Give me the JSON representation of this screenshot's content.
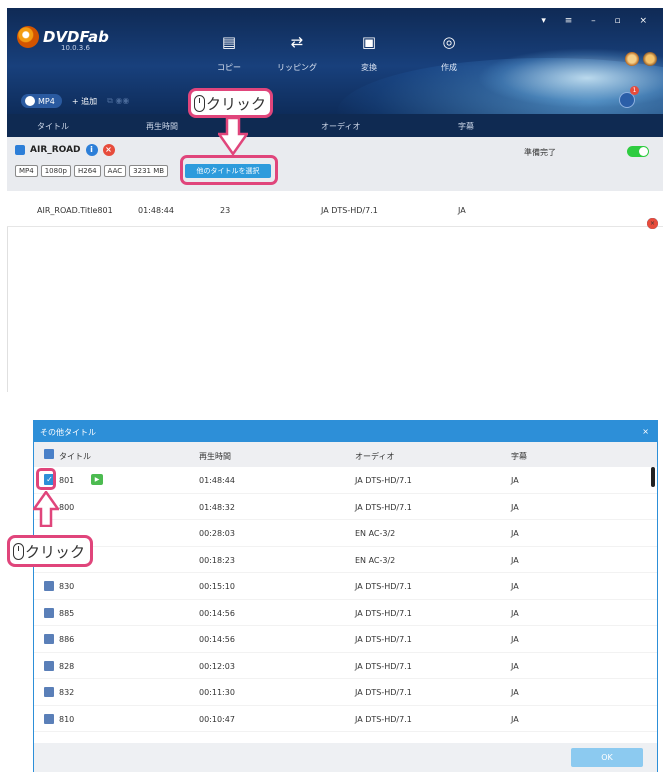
{
  "app": {
    "logo_text": "DVDFab",
    "version": "10.0.3.6",
    "window_controls": "▾ ≡ – ▫ ×",
    "nav": [
      {
        "label": "コピー",
        "icon": "copy-icon"
      },
      {
        "label": "リッピング",
        "icon": "ripper-icon"
      },
      {
        "label": "変換",
        "icon": "converter-icon"
      },
      {
        "label": "作成",
        "icon": "creator-icon"
      }
    ],
    "toolbar": {
      "profile": "MP4",
      "add": "+ 追加",
      "queue_badge": "1"
    },
    "columns": {
      "title": "タイトル",
      "duration": "再生時間",
      "audio": "オーディオ",
      "subtitle": "字幕"
    },
    "source": {
      "name": "AIR_ROAD",
      "tags": [
        "MP4",
        "1080p",
        "H264",
        "AAC",
        "3231 MB"
      ],
      "select_button": "他のタイトルを選択",
      "status": "準備完了"
    },
    "track": {
      "title": "AIR_ROAD.Title801",
      "duration": "01:48:44",
      "chapters": "23",
      "audio": "JA DTS-HD/7.1",
      "subtitle": "JA"
    }
  },
  "callouts": {
    "top": "クリック",
    "bottom": "クリック"
  },
  "dialog": {
    "title": "その他タイトル",
    "close": "×",
    "columns": {
      "title": "タイトル",
      "duration": "再生時間",
      "audio": "オーディオ",
      "subtitle": "字幕"
    },
    "rows": [
      {
        "title": "801",
        "duration": "01:48:44",
        "audio": "JA DTS-HD/7.1",
        "subtitle": "JA",
        "checked": true
      },
      {
        "title": "800",
        "duration": "01:48:32",
        "audio": "JA DTS-HD/7.1",
        "subtitle": "JA",
        "checked": false
      },
      {
        "title": "",
        "duration": "00:28:03",
        "audio": "EN AC-3/2",
        "subtitle": "JA",
        "checked": false
      },
      {
        "title": "",
        "duration": "00:18:23",
        "audio": "EN AC-3/2",
        "subtitle": "JA",
        "checked": false
      },
      {
        "title": "830",
        "duration": "00:15:10",
        "audio": "JA DTS-HD/7.1",
        "subtitle": "JA",
        "checked": false
      },
      {
        "title": "885",
        "duration": "00:14:56",
        "audio": "JA DTS-HD/7.1",
        "subtitle": "JA",
        "checked": false
      },
      {
        "title": "886",
        "duration": "00:14:56",
        "audio": "JA DTS-HD/7.1",
        "subtitle": "JA",
        "checked": false
      },
      {
        "title": "828",
        "duration": "00:12:03",
        "audio": "JA DTS-HD/7.1",
        "subtitle": "JA",
        "checked": false
      },
      {
        "title": "832",
        "duration": "00:11:30",
        "audio": "JA DTS-HD/7.1",
        "subtitle": "JA",
        "checked": false
      },
      {
        "title": "810",
        "duration": "00:10:47",
        "audio": "JA DTS-HD/7.1",
        "subtitle": "JA",
        "checked": false
      }
    ],
    "ok": "OK"
  },
  "colors": {
    "accent": "#2d8fd8",
    "callout": "#e0457b",
    "header": "#18407c"
  }
}
